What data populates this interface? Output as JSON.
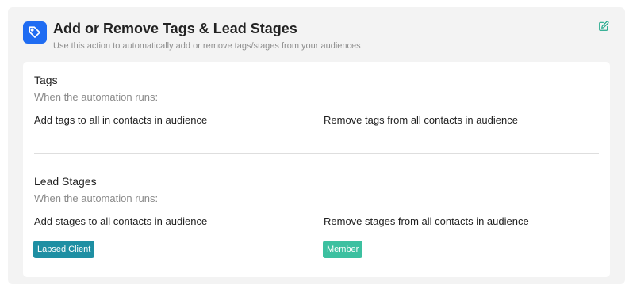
{
  "header": {
    "title": "Add or Remove Tags & Lead Stages",
    "subtitle": "Use this action to automatically add or remove tags/stages from your audiences",
    "icon": "tag-icon",
    "edit_icon": "edit-icon"
  },
  "tags": {
    "title": "Tags",
    "subtitle": "When the automation runs:",
    "add_label": "Add tags to all in contacts in audience",
    "remove_label": "Remove tags from all contacts in audience",
    "add_items": [],
    "remove_items": []
  },
  "lead_stages": {
    "title": "Lead Stages",
    "subtitle": "When the automation runs:",
    "add_label": "Add stages to all contacts in audience",
    "remove_label": "Remove stages from all contacts in audience",
    "add_items": [
      {
        "label": "Lapsed Client",
        "color": "#1e8fa3"
      }
    ],
    "remove_items": [
      {
        "label": "Member",
        "color": "#3cc0a0"
      }
    ]
  },
  "colors": {
    "accent": "#1f6cf2",
    "edit": "#20a88a"
  }
}
